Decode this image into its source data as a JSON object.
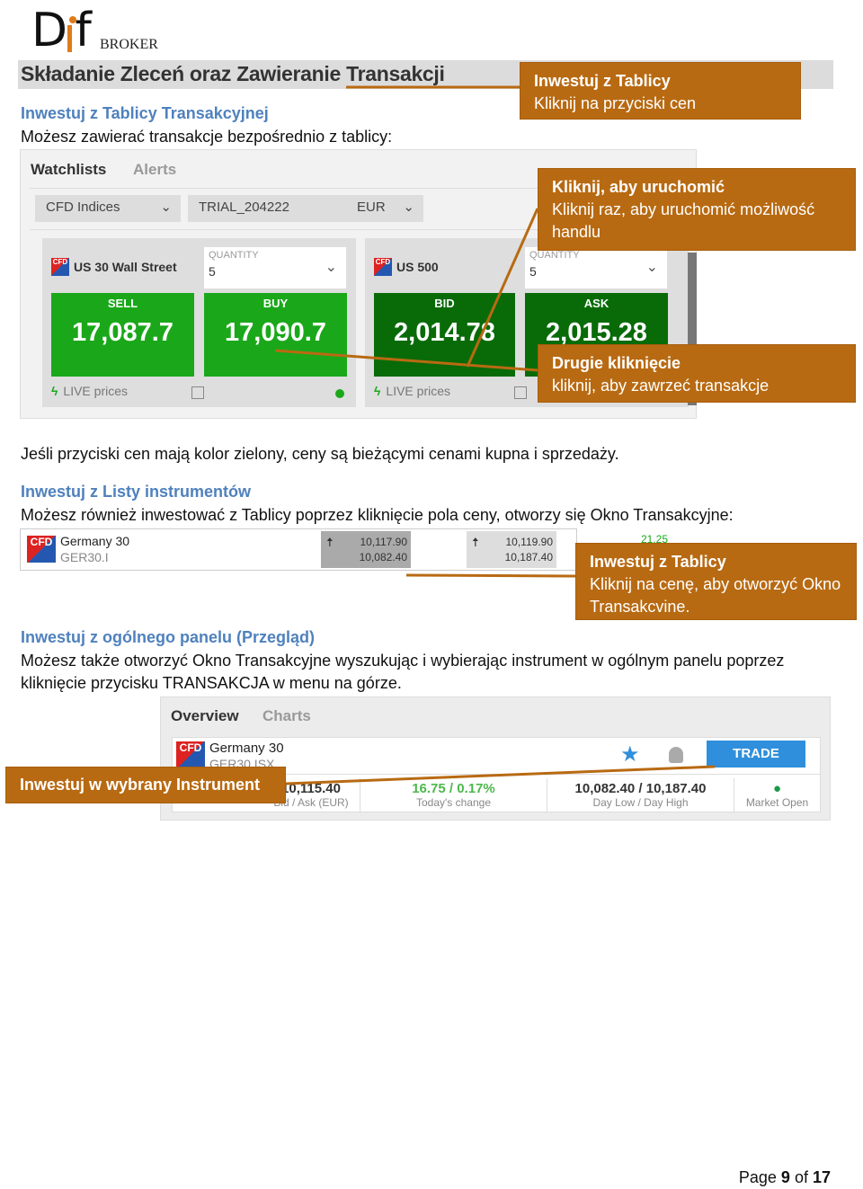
{
  "logo": {
    "text": "Dif",
    "sub": "BROKER"
  },
  "title": "Składanie Zleceń oraz Zawieranie Transakcji",
  "section1": {
    "heading": "Inwestuj z Tablicy Transakcyjnej",
    "text": "Możesz zawierać transakcje bezpośrednio z tablicy:"
  },
  "board": {
    "tabs": [
      "Watchlists",
      "Alerts"
    ],
    "list_dropdown": "CFD Indices",
    "account_dropdown": "TRIAL_204222",
    "currency": "EUR",
    "cards": [
      {
        "instrument": "US 30 Wall Street",
        "quantity_label": "QUANTITY",
        "quantity": "5",
        "left_label": "SELL",
        "left_price": "17,087.7",
        "right_label": "BUY",
        "right_price": "17,090.7",
        "footer": "LIVE prices"
      },
      {
        "instrument": "US 500",
        "quantity_label": "QUANTITY",
        "quantity": "5",
        "left_label": "BID",
        "left_price": "2,014.78",
        "right_label": "ASK",
        "right_price": "2,015.28",
        "footer": "LIVE prices"
      }
    ]
  },
  "callouts": {
    "c1": {
      "title": "Inwestuj z Tablicy",
      "text": "Kliknij na przyciski cen"
    },
    "c2": {
      "title": "Kliknij, aby uruchomić",
      "text": "Kliknij raz, aby uruchomić możliwość handlu"
    },
    "c3": {
      "title": "Drugie kliknięcie",
      "text": "kliknij, aby zawrzeć transakcje"
    },
    "c4": {
      "title": "Inwestuj z Tablicy",
      "text": "Kliknij na cenę, aby otworzyć Okno Transakcvine."
    },
    "c5": {
      "title": "Inwestuj w wybrany Instrument"
    }
  },
  "note": "Jeśli przyciski cen mają kolor zielony, ceny są bieżącymi cenami kupna i sprzedaży.",
  "section2": {
    "heading": "Inwestuj z Listy instrumentów",
    "text": "Możesz również inwestować z Tablicy poprzez kliknięcie pola ceny, otworzy się Okno Transakcyjne:"
  },
  "list_row": {
    "name": "Germany 30",
    "code": "GER30.I",
    "bid": "10,117.90",
    "bid_low": "10,082.40",
    "ask": "10,119.90",
    "ask_high": "10,187.40",
    "change": "21.25"
  },
  "section3": {
    "heading": "Inwestuj z ogólnego panelu (Przegląd)",
    "text": "Możesz także otworzyć Okno Transakcyjne wyszukując i wybierając instrument w ogólnym panelu poprzez kliknięcie przycisku TRANSAKCJA w menu na górze."
  },
  "overview": {
    "tabs": [
      "Overview",
      "Charts"
    ],
    "name": "Germany 30",
    "code": "GER30.ISX",
    "trade": "TRADE",
    "price": "10,115.40",
    "price_label": "Bid / Ask (EUR)",
    "change": "16.75 / 0.17%",
    "change_label": "Today's change",
    "range": "10,082.40 / 10,187.40",
    "range_label": "Day Low / Day High",
    "status_label": "Market Open"
  },
  "colors": {
    "callout": "#b86a12",
    "heading": "#4f81bd",
    "price_green": "#1aa81a",
    "price_dark_green": "#086b08",
    "trade_blue": "#2f8fdc"
  },
  "page": {
    "prefix": "Page",
    "current": "9",
    "of": "of",
    "total": "17"
  }
}
